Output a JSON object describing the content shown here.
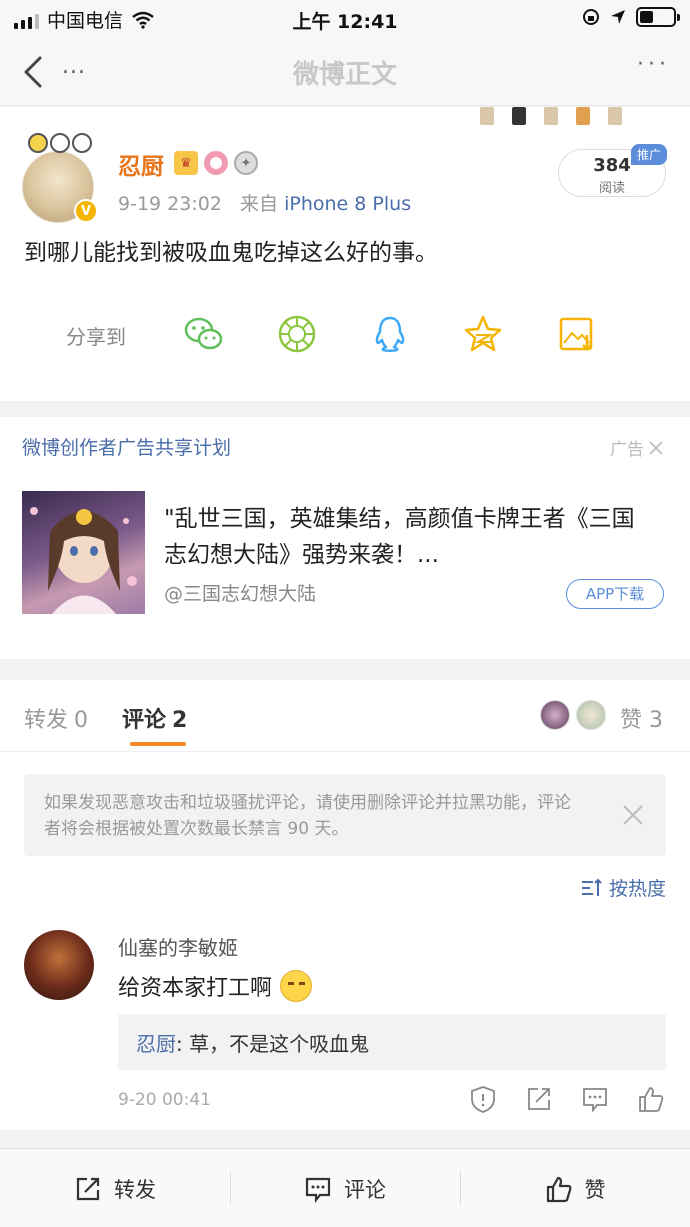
{
  "status_bar": {
    "carrier": "中国电信",
    "time": "上午 12:41"
  },
  "nav": {
    "title": "微博正文",
    "more_left": "...",
    "more_right": "···"
  },
  "post": {
    "author": "忍厨",
    "time": "9-19 23:02",
    "source_prefix": "来自",
    "device": "iPhone 8 Plus",
    "reads": "384",
    "reads_label": "阅读",
    "promo_tag": "推广",
    "text": "到哪儿能找到被吸血鬼吃掉这么好的事。",
    "share_label": "分享到",
    "share_icons": [
      "wechat-icon",
      "moments-icon",
      "qq-icon",
      "qzone-icon",
      "save-image-icon"
    ]
  },
  "ad": {
    "plan": "微博创作者广告共享计划",
    "tag": "广告",
    "title": "\"乱世三国，英雄集结，高颜值卡牌王者《三国志幻想大陆》强势来袭！...",
    "source": "@三国志幻想大陆",
    "download": "APP下载"
  },
  "tabs": {
    "repost": {
      "label": "转发",
      "count": "0"
    },
    "comment": {
      "label": "评论",
      "count": "2"
    },
    "like": {
      "label": "赞",
      "count": "3"
    }
  },
  "comments_section": {
    "notice": "如果发现恶意攻击和垃圾骚扰评论，请使用删除评论并拉黑功能，评论者将会根据被处置次数最长禁言 90 天。",
    "sort": "按热度"
  },
  "comment": {
    "name": "仙塞的李敏姬",
    "text": "给资本家打工啊",
    "reply_author": "忍厨",
    "reply_text": ": 草，不是这个吸血鬼",
    "time": "9-20 00:41"
  },
  "bottom_bar": {
    "repost": "转发",
    "comment": "评论",
    "like": "赞"
  },
  "colors": {
    "accent_orange": "#f08a24",
    "link_blue": "#4a6ea9",
    "author_orange": "#e8751a"
  }
}
